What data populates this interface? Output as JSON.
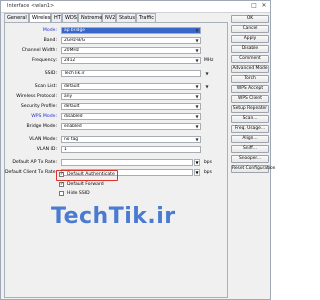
{
  "window": {
    "title": "Interface <wlan1>"
  },
  "tabs": [
    "General",
    "Wireless",
    "HT",
    "WDS",
    "Nstreme",
    "NV2",
    "Status",
    "Traffic"
  ],
  "form": {
    "mode": {
      "label": "Mode:",
      "value": "ap bridge"
    },
    "band": {
      "label": "Band:",
      "value": "2GHz-B/G"
    },
    "channel_width": {
      "label": "Channel Width:",
      "value": "20MHz"
    },
    "frequency": {
      "label": "Frequency:",
      "value": "2412",
      "unit": "MHz"
    },
    "ssid": {
      "label": "SSID:",
      "value": "TechTik.ir"
    },
    "scan_list": {
      "label": "Scan List:",
      "value": "default"
    },
    "wireless_protocol": {
      "label": "Wireless Protocol:",
      "value": "any"
    },
    "security_profile": {
      "label": "Security Profile:",
      "value": "default"
    },
    "wps_mode": {
      "label": "WPS Mode:",
      "value": "disabled"
    },
    "bridge_mode": {
      "label": "Bridge Mode:",
      "value": "enabled"
    },
    "vlan_mode": {
      "label": "VLAN Mode:",
      "value": "no tag"
    },
    "vlan_id": {
      "label": "VLAN ID:",
      "value": "1"
    },
    "default_ap_tx_rate": {
      "label": "Default AP Tx Rate:",
      "value": "",
      "unit": "bps"
    },
    "default_client_tx_rate": {
      "label": "Default Client Tx Rate:",
      "value": "",
      "unit": "bps"
    },
    "checkboxes": [
      {
        "label": "Default Authenticate",
        "checked": true
      },
      {
        "label": "Default Forward",
        "checked": true
      },
      {
        "label": "Hide SSID",
        "checked": false
      }
    ]
  },
  "buttons": [
    "OK",
    "Cancel",
    "Apply",
    "Disable",
    "Comment",
    "Advanced Mode",
    "Torch",
    "WPS Accept",
    "WPS Client",
    "Setup Repeater",
    "Scan...",
    "Freq. Usage...",
    "Align...",
    "Sniff...",
    "Snooper...",
    "Reset Configuration"
  ],
  "watermark": "TechTik.ir",
  "colors": {
    "selection": "#3767c9",
    "link_label": "#2233cc",
    "highlight_box": "#e0302a",
    "watermark": "#4a7bd0"
  }
}
